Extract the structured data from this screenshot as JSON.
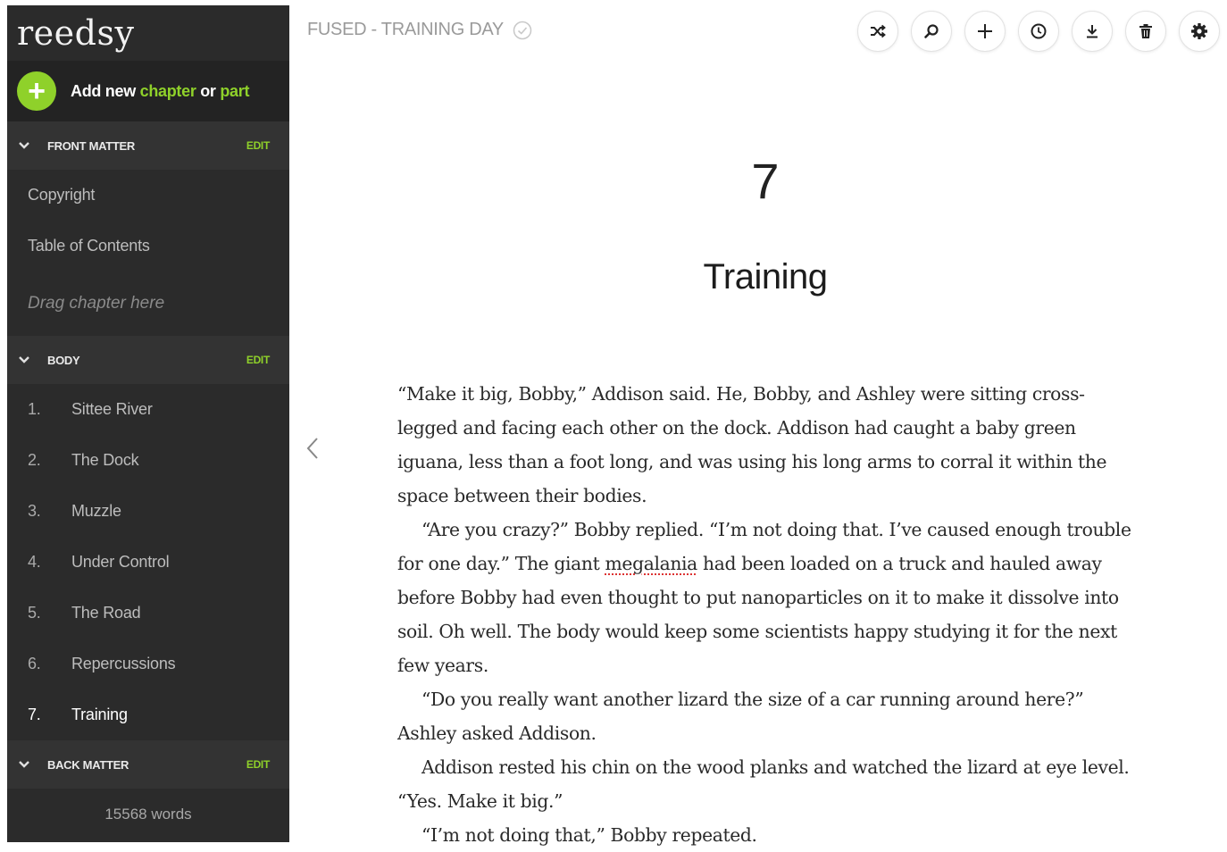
{
  "app": {
    "logo": "reedsy"
  },
  "header": {
    "title": "FUSED - TRAINING DAY"
  },
  "toolbar": {
    "buttons": [
      {
        "name": "shuffle",
        "icon": "shuffle-icon"
      },
      {
        "name": "search",
        "icon": "search-icon"
      },
      {
        "name": "add",
        "icon": "plus-icon"
      },
      {
        "name": "history",
        "icon": "clock-icon"
      },
      {
        "name": "download",
        "icon": "download-icon"
      },
      {
        "name": "delete",
        "icon": "trash-icon"
      },
      {
        "name": "settings",
        "icon": "gear-icon"
      }
    ]
  },
  "sidebar": {
    "add": {
      "prefix": "Add new ",
      "chapter": "chapter",
      "or": " or ",
      "part": "part"
    },
    "front_matter": {
      "title": "FRONT MATTER",
      "edit": "EDIT",
      "items": [
        "Copyright",
        "Table of Contents"
      ],
      "drag": "Drag chapter here"
    },
    "body": {
      "title": "BODY",
      "edit": "EDIT",
      "items": [
        {
          "num": "1.",
          "label": "Sittee River"
        },
        {
          "num": "2.",
          "label": "The Dock"
        },
        {
          "num": "3.",
          "label": "Muzzle"
        },
        {
          "num": "4.",
          "label": "Under Control"
        },
        {
          "num": "5.",
          "label": "The Road"
        },
        {
          "num": "6.",
          "label": "Repercussions"
        },
        {
          "num": "7.",
          "label": "Training"
        }
      ]
    },
    "back_matter": {
      "title": "BACK MATTER",
      "edit": "EDIT"
    },
    "word_count": "15568 words"
  },
  "chapter": {
    "number": "7",
    "title": "Training",
    "p1": "“Make it big, Bobby,” Addison said. He, Bobby, and Ashley were sitting cross-legged and facing each other on the dock. Addison had caught a baby green iguana, less than a foot long, and was using his long arms to corral it within the space between their bodies.",
    "p2a": "“Are you crazy?” Bobby replied. “I’m not doing that. I’ve caused enough trouble for one day.” The giant ",
    "p2word": "megalania",
    "p2b": " had been loaded on a truck and hauled away before Bobby had even thought to put nanoparticles on it to make it dissolve into soil. Oh well. The body would keep some scientists happy studying it for the next few years.",
    "p3": "“Do you really want another lizard the size of a car running around here?” Ashley asked Addison.",
    "p4": "Addison rested his chin on the wood planks and watched the lizard at eye level. “Yes. Make it big.”",
    "p5": "“I’m not doing that,” Bobby repeated."
  },
  "colors": {
    "accent": "#8fd12a",
    "sidebar_bg": "#2b2b2b"
  }
}
